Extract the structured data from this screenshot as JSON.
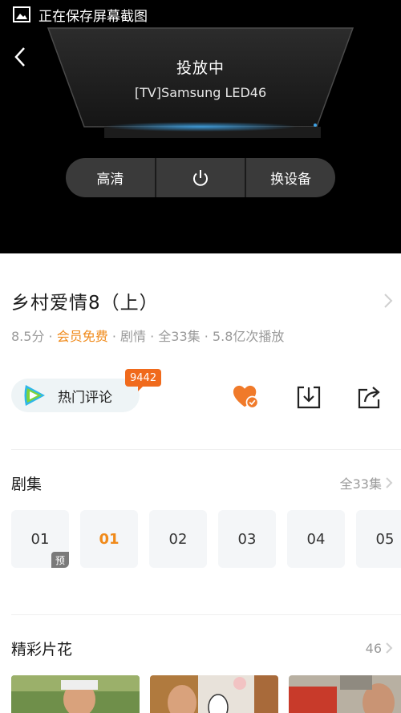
{
  "status_bar": {
    "text": "正在保存屏幕截图",
    "icon": "image-icon"
  },
  "cast": {
    "state": "投放中",
    "device": "[TV]Samsung LED46",
    "controls": [
      {
        "label": "高清"
      },
      {
        "label": "",
        "icon": "power-icon"
      },
      {
        "label": "换设备"
      }
    ]
  },
  "show": {
    "title": "乡村爱情8（上）",
    "score": "8.5分",
    "vip": "会员免费",
    "genre": "剧情",
    "episodes_total": "全33集",
    "plays": "5.8亿次播放"
  },
  "actions": {
    "comment_label": "热门评论",
    "comment_count": "9442",
    "icons": [
      "heart-check-icon",
      "download-icon",
      "share-icon"
    ]
  },
  "episodes_section": {
    "title": "剧集",
    "more": "全33集",
    "items": [
      {
        "label": "01",
        "tag": "预"
      },
      {
        "label": "01",
        "active": true
      },
      {
        "label": "02"
      },
      {
        "label": "03"
      },
      {
        "label": "04"
      },
      {
        "label": "05"
      }
    ]
  },
  "clips_section": {
    "title": "精彩片花",
    "count": "46"
  },
  "colors": {
    "accent": "#f08a1a",
    "badge": "#f06a1c",
    "cast_bg": "#000000"
  }
}
